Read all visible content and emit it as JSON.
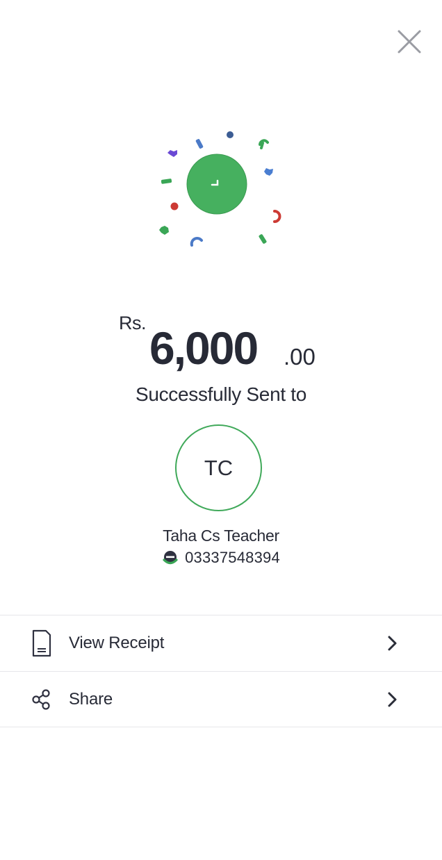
{
  "colors": {
    "success_green": "#40a95a",
    "text_primary": "#272a36",
    "divider": "#e6e6ea"
  },
  "icons": {
    "close": "close-icon",
    "success": "checkmark-icon",
    "wallet": "wallet-logo-icon",
    "receipt": "receipt-icon",
    "share": "share-icon",
    "chevron": "chevron-right-icon"
  },
  "amount": {
    "currency": "Rs.",
    "whole": "6,000",
    "decimals": ".00"
  },
  "status": {
    "message": "Successfully Sent to"
  },
  "recipient": {
    "initials": "TC",
    "name": "Taha Cs Teacher",
    "phone": "03337548394"
  },
  "actions": [
    {
      "label": "View Receipt"
    },
    {
      "label": "Share"
    }
  ]
}
